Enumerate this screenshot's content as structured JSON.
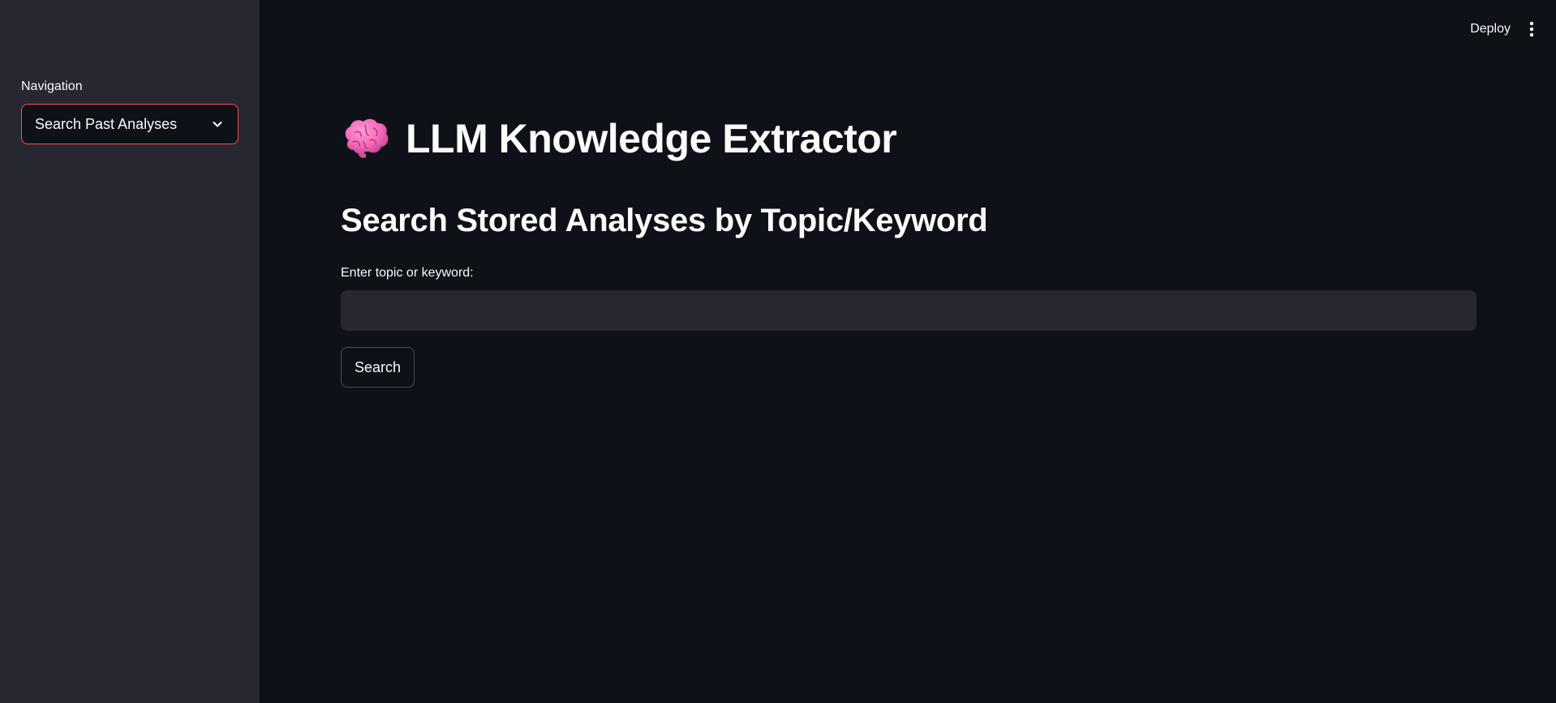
{
  "sidebar": {
    "nav_label": "Navigation",
    "nav_select": {
      "selected": "Search Past Analyses",
      "icon": "chevron-down-icon"
    }
  },
  "header": {
    "deploy_label": "Deploy",
    "menu_icon": "kebab-menu-icon"
  },
  "main": {
    "title_icon": "brain-icon",
    "title": "LLM Knowledge Extractor",
    "section_heading": "Search Stored Analyses by Topic/Keyword",
    "search_field": {
      "label": "Enter topic or keyword:",
      "value": "",
      "placeholder": ""
    },
    "search_button_label": "Search"
  },
  "colors": {
    "background": "#0e1117",
    "sidebar": "#262730",
    "accent": "#ff4b4b",
    "text": "#fafafa"
  }
}
